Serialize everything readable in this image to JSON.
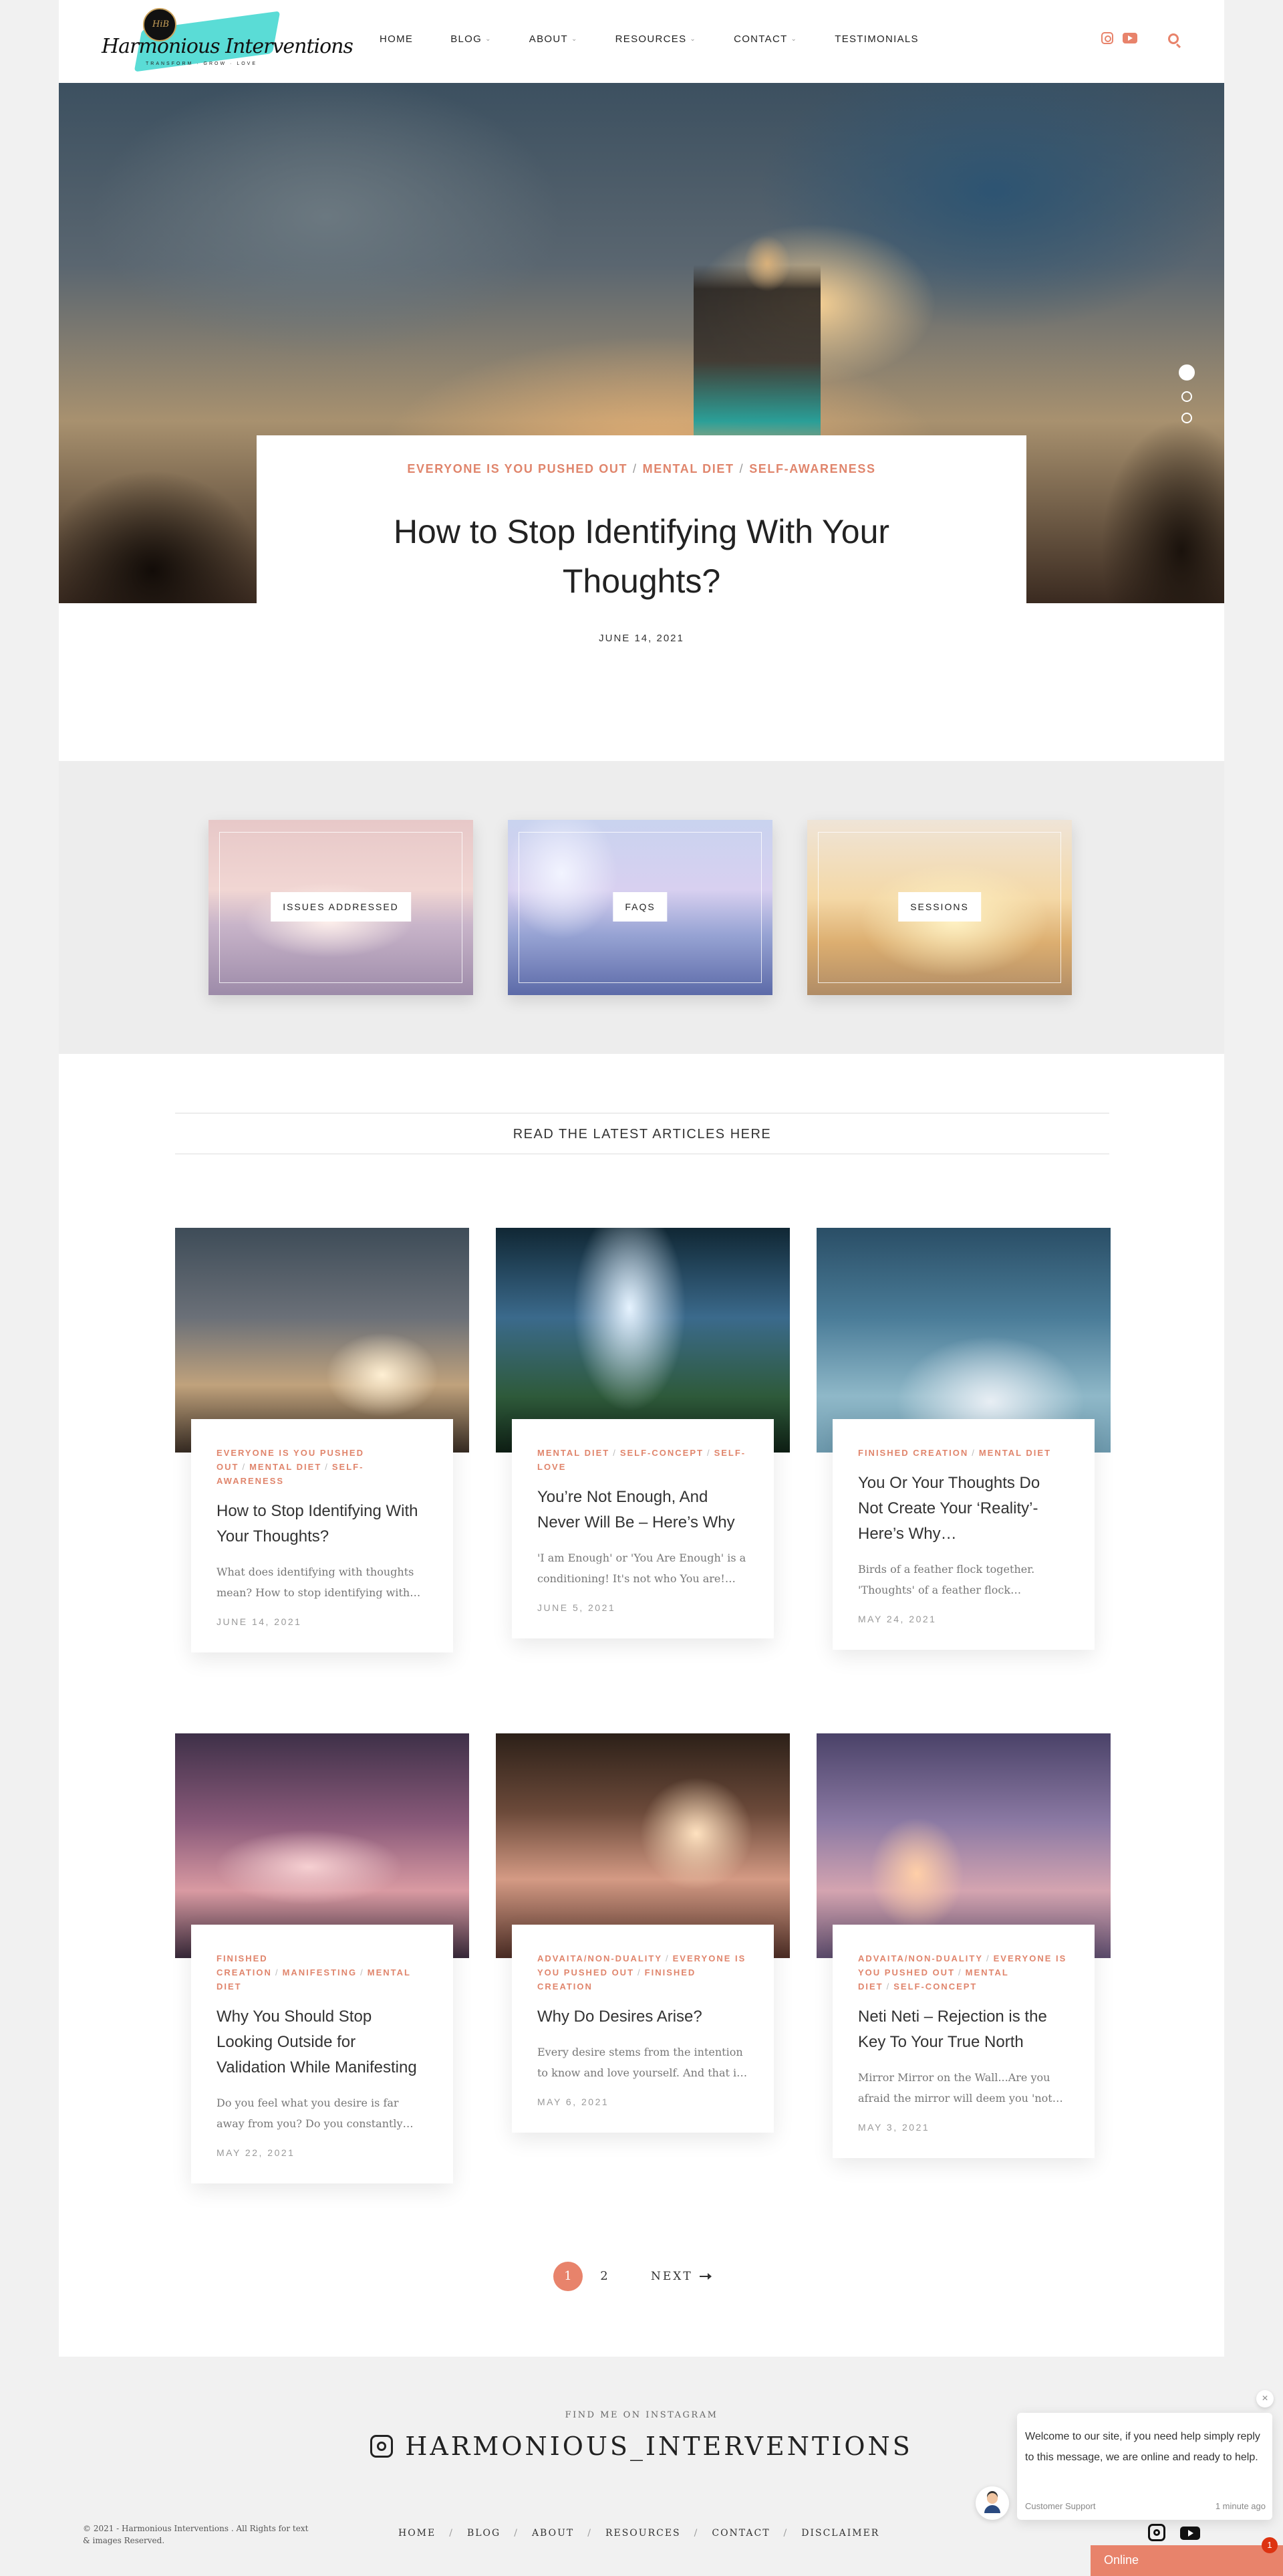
{
  "logo": {
    "name": "Harmonious Interventions",
    "tagline": "TRANSFORM · GROW · LOVE",
    "seal": "HiB"
  },
  "nav": [
    {
      "label": "HOME",
      "dropdown": false
    },
    {
      "label": "BLOG",
      "dropdown": true
    },
    {
      "label": "ABOUT",
      "dropdown": true
    },
    {
      "label": "RESOURCES",
      "dropdown": true
    },
    {
      "label": "CONTACT",
      "dropdown": true
    },
    {
      "label": "TESTIMONIALS",
      "dropdown": false
    }
  ],
  "hero": {
    "categories": [
      "EVERYONE IS YOU PUSHED OUT",
      "MENTAL DIET",
      "SELF-AWARENESS"
    ],
    "title": "How to Stop Identifying With Your Thoughts?",
    "date": "JUNE 14, 2021",
    "slides": 3,
    "active_slide": 1
  },
  "features": [
    {
      "label": "ISSUES ADDRESSED"
    },
    {
      "label": "FAQS"
    },
    {
      "label": "SESSIONS"
    }
  ],
  "latest_heading": "READ THE LATEST ARTICLES HERE",
  "posts": [
    {
      "categories": [
        "EVERYONE IS YOU PUSHED OUT",
        "MENTAL DIET",
        "SELF-AWARENESS"
      ],
      "title": "How to Stop Identifying With Your Thoughts?",
      "excerpt": "What does identifying with thoughts mean? How to stop identifying with…",
      "date": "JUNE 14, 2021"
    },
    {
      "categories": [
        "MENTAL DIET",
        "SELF-CONCEPT",
        "SELF-LOVE"
      ],
      "title": "You’re Not Enough, And Never Will Be – Here’s Why",
      "excerpt": "'I am Enough' or 'You Are Enough' is a conditioning! It's not who You are!…",
      "date": "JUNE 5, 2021"
    },
    {
      "categories": [
        "FINISHED CREATION",
        "MENTAL DIET"
      ],
      "title": "You Or Your Thoughts Do Not Create Your ‘Reality’- Here’s Why…",
      "excerpt": "Birds of a feather flock together. 'Thoughts' of a feather flock…",
      "date": "MAY 24, 2021"
    },
    {
      "categories": [
        "FINISHED CREATION",
        "MANIFESTING",
        "MENTAL DIET"
      ],
      "title": "Why You Should Stop Looking Outside for Validation While Manifesting",
      "excerpt": "Do you feel what you desire is far away from you? Do you constantly…",
      "date": "MAY 22, 2021"
    },
    {
      "categories": [
        "ADVAITA/NON-DUALITY",
        "EVERYONE IS YOU PUSHED OUT",
        "FINISHED CREATION"
      ],
      "title": "Why Do Desires Arise?",
      "excerpt": "Every desire stems from the intention to know and love yourself. And that i…",
      "date": "MAY 6, 2021"
    },
    {
      "categories": [
        "ADVAITA/NON-DUALITY",
        "EVERYONE IS YOU PUSHED OUT",
        "MENTAL DIET",
        "SELF-CONCEPT"
      ],
      "title": "Neti Neti – Rejection is the Key To Your True North",
      "excerpt": "Mirror Mirror on the Wall...Are you afraid the mirror will deem you 'not…",
      "date": "MAY 3, 2021"
    }
  ],
  "pagination": {
    "pages": [
      "1",
      "2"
    ],
    "current": "1",
    "next_label": "NEXT"
  },
  "footer": {
    "insta_label": "FIND ME ON INSTAGRAM",
    "insta_handle": "HARMONIOUS_INTERVENTIONS",
    "copyright": "© 2021 - Harmonious Interventions . All Rights for text & images  Reserved.",
    "links": [
      "HOME",
      "BLOG",
      "ABOUT",
      "RESOURCES",
      "CONTACT",
      "DISCLAIMER"
    ]
  },
  "chat": {
    "message": "Welcome to our site, if you need help simply reply to this message, we are online and ready to help.",
    "agent": "Customer Support",
    "time": "1 minute ago",
    "status": "Online",
    "unread": "1",
    "close": "×"
  },
  "colors": {
    "accent": "#e8836b",
    "category": "#e0856c"
  }
}
